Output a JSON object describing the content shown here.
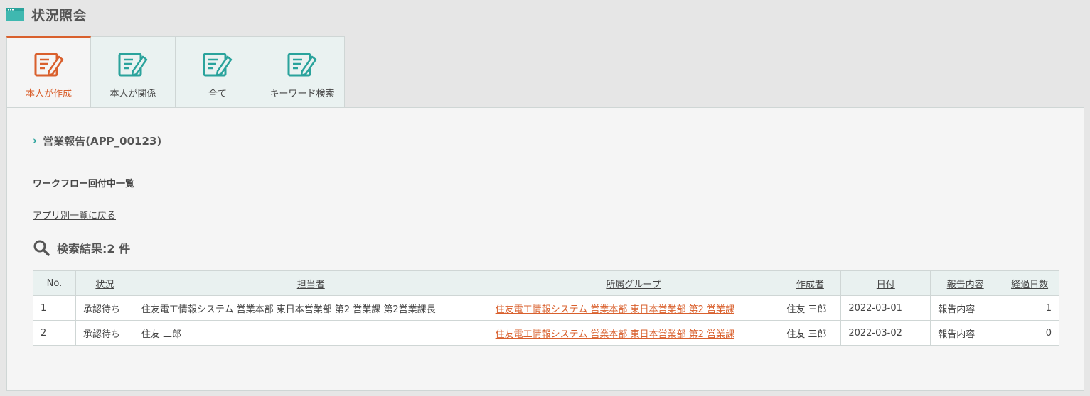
{
  "page": {
    "title": "状況照会"
  },
  "tabs": [
    {
      "label": "本人が作成",
      "active": true
    },
    {
      "label": "本人が関係",
      "active": false
    },
    {
      "label": "全て",
      "active": false
    },
    {
      "label": "キーワード検索",
      "active": false
    }
  ],
  "section": {
    "title": "営業報告(APP_00123)"
  },
  "workflow_label": "ワークフロー回付中一覧",
  "back_link": "アプリ別一覧に戻る",
  "result_title": "検索結果:2 件",
  "table": {
    "headers": [
      "No.",
      "状況",
      "担当者",
      "所属グループ",
      "作成者",
      "日付",
      "報告内容",
      "経過日数"
    ],
    "rows": [
      {
        "no": "1",
        "status": "承認待ち",
        "assignee": "住友電工情報システム 営業本部 東日本営業部 第2 営業課 第2営業課長",
        "group": "住友電工情報システム 営業本部 東日本営業部 第2 営業課",
        "creator": "住友 三郎",
        "date": "2022-03-01",
        "report": "報告内容",
        "days": "1"
      },
      {
        "no": "2",
        "status": "承認待ち",
        "assignee": "住友 二郎",
        "group": "住友電工情報システム 営業本部 東日本営業部 第2 営業課",
        "creator": "住友 三郎",
        "date": "2022-03-02",
        "report": "報告内容",
        "days": "0"
      }
    ]
  },
  "colors": {
    "accent": "#d9602d",
    "teal": "#2aa39c",
    "tab_bg": "#eaf2f1",
    "header_bg": "#e9f1f0"
  }
}
